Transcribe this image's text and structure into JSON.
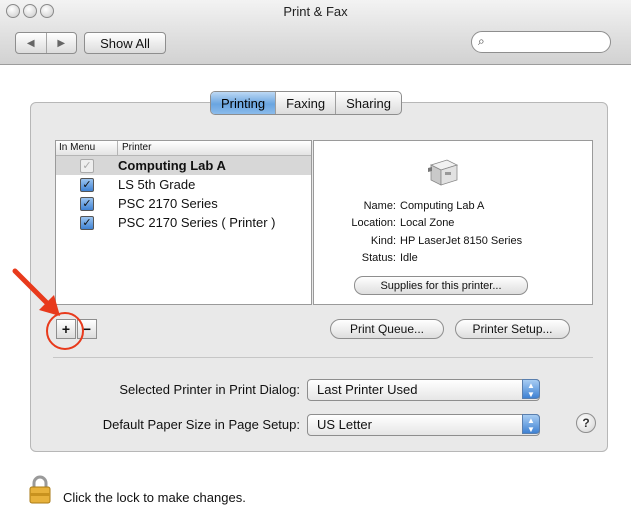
{
  "window": {
    "title": "Print & Fax"
  },
  "toolbar": {
    "back_glyph": "◀",
    "forward_glyph": "▶",
    "show_all_label": "Show All",
    "search_icon": "⌕",
    "search_value": ""
  },
  "tabs": [
    {
      "label": "Printing",
      "active": true
    },
    {
      "label": "Faxing",
      "active": false
    },
    {
      "label": "Sharing",
      "active": false
    }
  ],
  "printer_list": {
    "col_in_menu": "In Menu",
    "col_printer": "Printer",
    "rows": [
      {
        "name": "Computing Lab A",
        "checked": true,
        "selected": true,
        "enabled": false
      },
      {
        "name": "LS 5th Grade",
        "checked": true,
        "selected": false,
        "enabled": true
      },
      {
        "name": "PSC 2170 Series",
        "checked": true,
        "selected": false,
        "enabled": true
      },
      {
        "name": "PSC 2170 Series ( Printer )",
        "checked": true,
        "selected": false,
        "enabled": true
      }
    ]
  },
  "printer_info": {
    "name_label": "Name:",
    "name_value": "Computing Lab A",
    "location_label": "Location:",
    "location_value": "Local Zone",
    "kind_label": "Kind:",
    "kind_value": "HP LaserJet 8150 Series",
    "status_label": "Status:",
    "status_value": "Idle",
    "supplies_label": "Supplies for this printer..."
  },
  "buttons": {
    "add": "+",
    "remove": "−",
    "print_queue": "Print Queue...",
    "printer_setup": "Printer Setup..."
  },
  "settings": {
    "selected_printer_label": "Selected Printer in Print Dialog:",
    "selected_printer_value": "Last Printer Used",
    "paper_size_label": "Default Paper Size in Page Setup:",
    "paper_size_value": "US Letter",
    "help": "?"
  },
  "footer": {
    "lock_text": "Click the lock to make changes."
  },
  "colors": {
    "annotation": "#e83a1c",
    "accent": "#3f82d3"
  }
}
